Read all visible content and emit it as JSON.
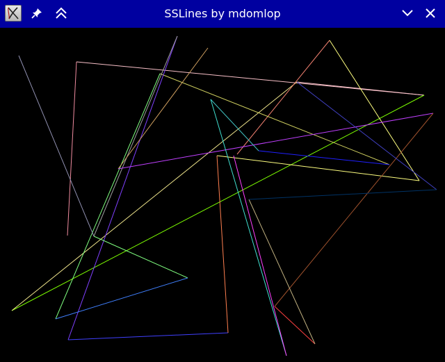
{
  "window": {
    "title": "SSLines by mdomlop",
    "titlebar_color": "#0000a0",
    "background_color": "#000000"
  },
  "titlebar_buttons": {
    "left": [
      {
        "name": "app-menu-icon",
        "icon": "xfce-x-icon"
      },
      {
        "name": "pin-icon",
        "icon": "pushpin-icon"
      },
      {
        "name": "shade-icon",
        "icon": "double-chevron-up-icon"
      }
    ],
    "right": [
      {
        "name": "minimize-icon",
        "icon": "chevron-down-icon"
      },
      {
        "name": "close-icon",
        "icon": "x-icon"
      }
    ]
  },
  "lines": [
    {
      "color": "#f08ca0",
      "points": [
        [
          110,
          89
        ],
        [
          97,
          339
        ]
      ]
    },
    {
      "color": "#f8c0c8",
      "points": [
        [
          110,
          89
        ],
        [
          610,
          137
        ]
      ]
    },
    {
      "color": "#f8c0c8",
      "points": [
        [
          610,
          137
        ],
        [
          427,
          118
        ]
      ]
    },
    {
      "color": "#7cfc00",
      "points": [
        [
          17,
          447
        ],
        [
          610,
          137
        ]
      ]
    },
    {
      "color": "#f0e68c",
      "points": [
        [
          17,
          447
        ],
        [
          427,
          118
        ]
      ]
    },
    {
      "color": "#ffff80",
      "points": [
        [
          474,
          58
        ],
        [
          603,
          260
        ]
      ]
    },
    {
      "color": "#ffff80",
      "points": [
        [
          603,
          260
        ],
        [
          312,
          224
        ]
      ]
    },
    {
      "color": "#f08070",
      "points": [
        [
          474,
          58
        ],
        [
          341,
          222
        ]
      ]
    },
    {
      "color": "#d0d060",
      "points": [
        [
          230,
          106
        ],
        [
          560,
          237
        ]
      ]
    },
    {
      "color": "#80ff80",
      "points": [
        [
          230,
          106
        ],
        [
          80,
          459
        ]
      ]
    },
    {
      "color": "#8040ff",
      "points": [
        [
          255,
          52
        ],
        [
          98,
          489
        ]
      ]
    },
    {
      "color": "#4040ff",
      "points": [
        [
          98,
          489
        ],
        [
          328,
          479
        ]
      ]
    },
    {
      "color": "#ff7f50",
      "points": [
        [
          328,
          479
        ],
        [
          312,
          224
        ]
      ]
    },
    {
      "color": "#9090b0",
      "points": [
        [
          27,
          80
        ],
        [
          135,
          340
        ]
      ]
    },
    {
      "color": "#a0a0a0",
      "points": [
        [
          255,
          52
        ],
        [
          135,
          340
        ]
      ]
    },
    {
      "color": "#80ff80",
      "points": [
        [
          135,
          340
        ],
        [
          270,
          400
        ]
      ]
    },
    {
      "color": "#4080ff",
      "points": [
        [
          270,
          400
        ],
        [
          80,
          459
        ]
      ]
    },
    {
      "color": "#d0a060",
      "points": [
        [
          299,
          69
        ],
        [
          170,
          243
        ]
      ]
    },
    {
      "color": "#c040ff",
      "points": [
        [
          170,
          243
        ],
        [
          623,
          163
        ]
      ]
    },
    {
      "color": "#a0522d",
      "points": [
        [
          623,
          163
        ],
        [
          395,
          441
        ]
      ]
    },
    {
      "color": "#ff4040",
      "points": [
        [
          395,
          441
        ],
        [
          453,
          495
        ]
      ]
    },
    {
      "color": "#c0b080",
      "points": [
        [
          453,
          495
        ],
        [
          358,
          287
        ]
      ]
    },
    {
      "color": "#2020ff",
      "points": [
        [
          372,
          217
        ],
        [
          560,
          237
        ]
      ]
    },
    {
      "color": "#40c0c0",
      "points": [
        [
          303,
          143
        ],
        [
          372,
          217
        ]
      ]
    },
    {
      "color": "#40e0d0",
      "points": [
        [
          303,
          143
        ],
        [
          412,
          512
        ]
      ]
    },
    {
      "color": "#ff40ff",
      "points": [
        [
          336,
          224
        ],
        [
          412,
          512
        ]
      ]
    },
    {
      "color": "#4040c0",
      "points": [
        [
          427,
          118
        ],
        [
          628,
          273
        ]
      ]
    },
    {
      "color": "#003366",
      "points": [
        [
          628,
          273
        ],
        [
          358,
          287
        ]
      ]
    }
  ]
}
